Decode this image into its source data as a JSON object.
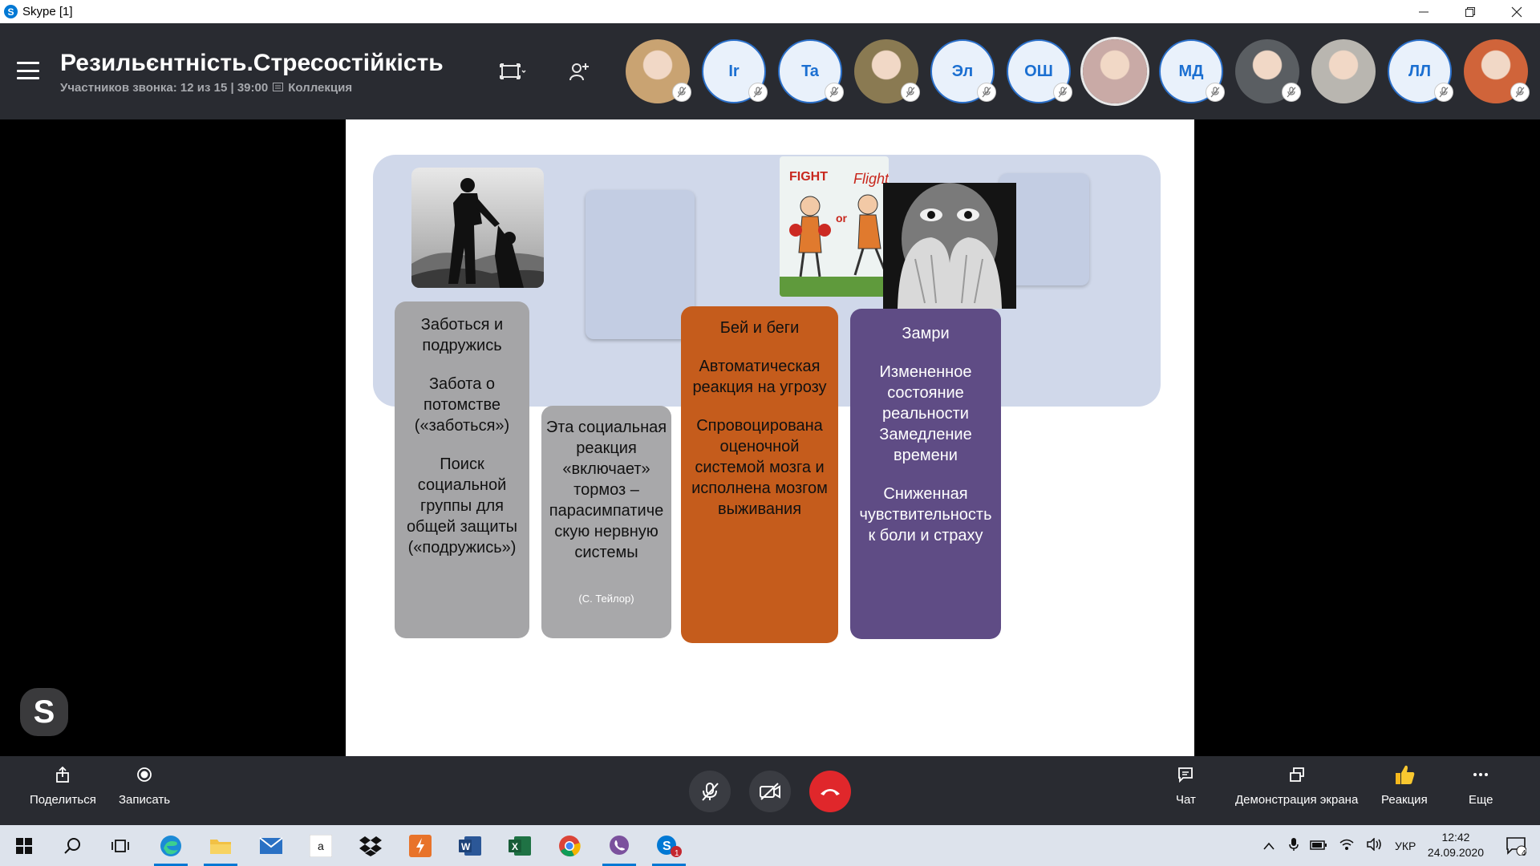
{
  "window": {
    "title": "Skype [1]",
    "logo": "S",
    "controls": [
      "minimize-icon",
      "restore-icon",
      "close-icon"
    ]
  },
  "call": {
    "title": "Резильєнтність.Стресостійкість",
    "participants_info": "Участников звонка: 12 из 15 | 39:00",
    "collection_label": "Коллекция",
    "participants": [
      {
        "type": "photo",
        "color": "#c9a372",
        "muted": true
      },
      {
        "type": "initials",
        "label": "Ir",
        "muted": true
      },
      {
        "type": "initials",
        "label": "Ta",
        "muted": true
      },
      {
        "type": "photo",
        "color": "#8a7a52",
        "muted": true
      },
      {
        "type": "initials",
        "label": "Эл",
        "muted": true
      },
      {
        "type": "initials",
        "label": "ОШ",
        "muted": true
      },
      {
        "type": "photo",
        "color": "#c9aaa6",
        "muted": false,
        "active": true
      },
      {
        "type": "initials",
        "label": "МД",
        "muted": true
      },
      {
        "type": "photo",
        "color": "#5a5e62",
        "muted": true
      },
      {
        "type": "photo",
        "color": "#b9b6b0",
        "muted": false
      },
      {
        "type": "initials",
        "label": "ЛЛ",
        "muted": true
      },
      {
        "type": "photo",
        "color": "#d0643a",
        "muted": true
      }
    ]
  },
  "slide": {
    "columns": [
      {
        "paragraphs": [
          "Заботься и\nподружись",
          "Забота о\nпотомстве\n(«заботься»)",
          "Поиск\nсоциальной\nгруппы для\nобщей защиты\n(«подружись»)"
        ]
      },
      {
        "paragraphs": [
          "Эта социальная\nреакция\n«включает»\nтормоз –\nпарасимпатиче\nскую нервную\nсистемы"
        ],
        "credit": "(С. Тейлор)"
      },
      {
        "paragraphs": [
          "Бей и беги",
          "Автоматическая\nреакция на угрозу",
          "Спровоцирована\nоценочной\nсистемой мозга и\nисполнена мозгом\nвыживания"
        ]
      },
      {
        "paragraphs": [
          "Замри",
          "Измененное\nсостояние\nреальности\nЗамедление\nвремени",
          "Сниженная\nчувствительность\nк боли и страху"
        ]
      }
    ],
    "fight_flight_image": {
      "left_text": "FIGHT",
      "middle_text": "or",
      "right_text": "Flight"
    }
  },
  "controls": {
    "share_label": "Поделиться",
    "record_label": "Записать",
    "chat_label": "Чат",
    "screen_share_label": "Демонстрация экрана",
    "reaction_label": "Реакция",
    "more_label": "Еще"
  },
  "taskbar": {
    "language": "УКР",
    "time": "12:42",
    "date": "24.09.2020",
    "notifications": "4",
    "skype_badge": "1"
  }
}
